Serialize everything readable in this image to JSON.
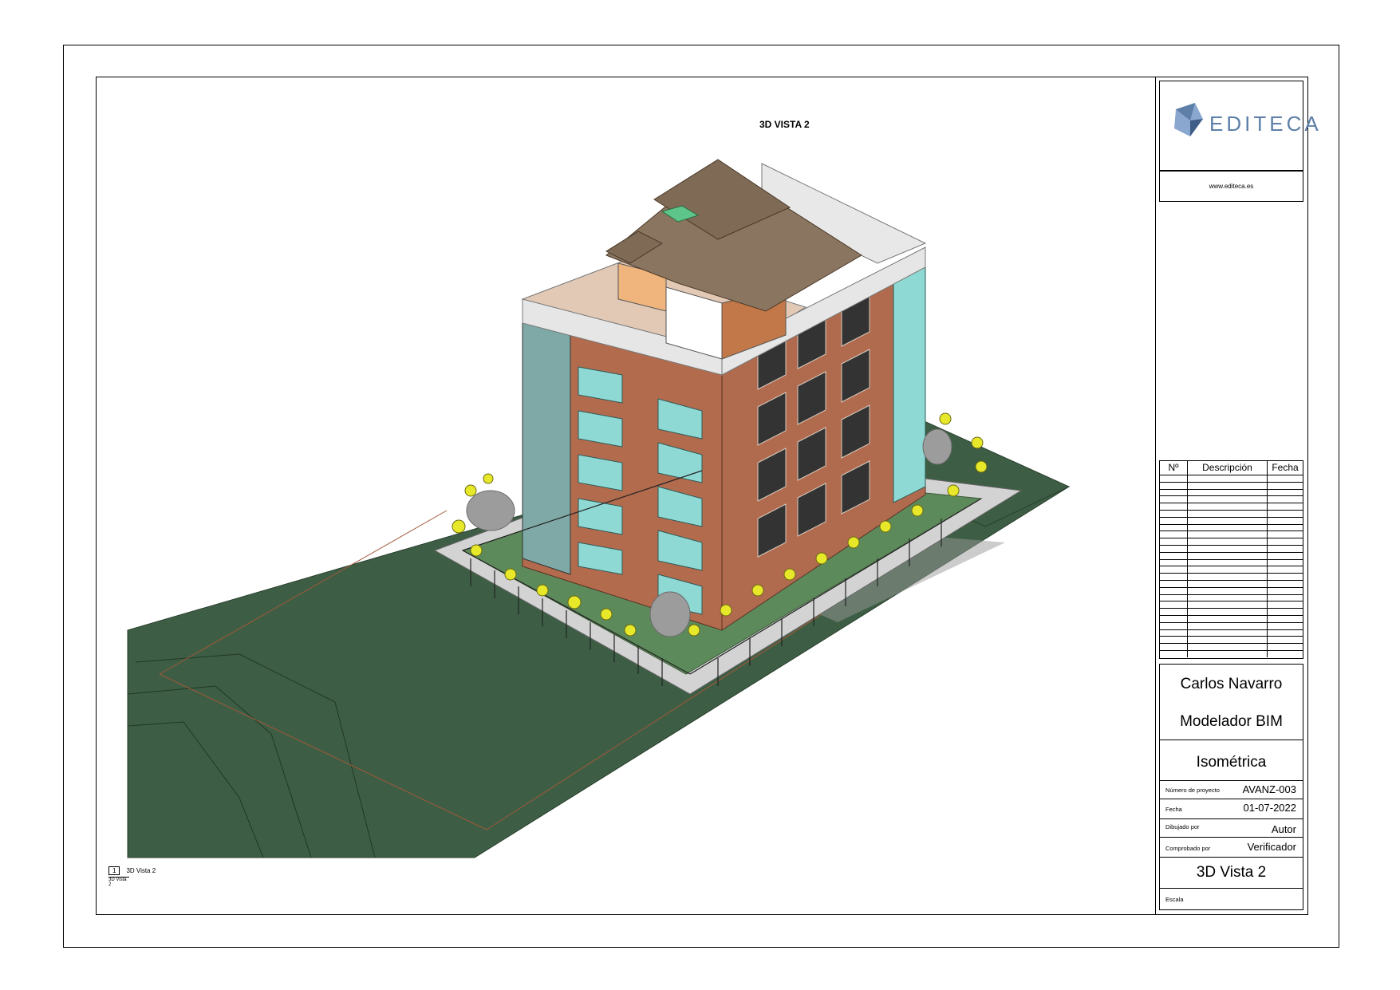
{
  "view": {
    "title": "3D VISTA 2"
  },
  "brand": {
    "name": "EDITECA",
    "url": "www.editeca.es",
    "color": "#5d7fa8"
  },
  "revisions": {
    "headers": [
      "Nº",
      "Descripción",
      "Fecha"
    ],
    "rows": 26
  },
  "titleblock": {
    "author_name": "Carlos Navarro",
    "author_role": "Modelador BIM",
    "sheet_type": "Isométrica",
    "fields": [
      {
        "label": "Número de proyecto",
        "value": "AVANZ-003"
      },
      {
        "label": "Fecha",
        "value": "01-07-2022"
      },
      {
        "label": "Dibujado por",
        "value": "Autor"
      },
      {
        "label": "Comprobado por",
        "value": "Verificador"
      }
    ],
    "sheet_name": "3D Vista 2",
    "scale_label": "Escala"
  },
  "view_ref": {
    "number": "1",
    "name": "3D Vista 2",
    "sub": "3D Vista 2"
  },
  "colors": {
    "terrain": "#3d5e44",
    "brick": "#b36b4d",
    "roof": "#8a7560",
    "glass": "#8fd9d4",
    "path": "#c8c8c8"
  }
}
